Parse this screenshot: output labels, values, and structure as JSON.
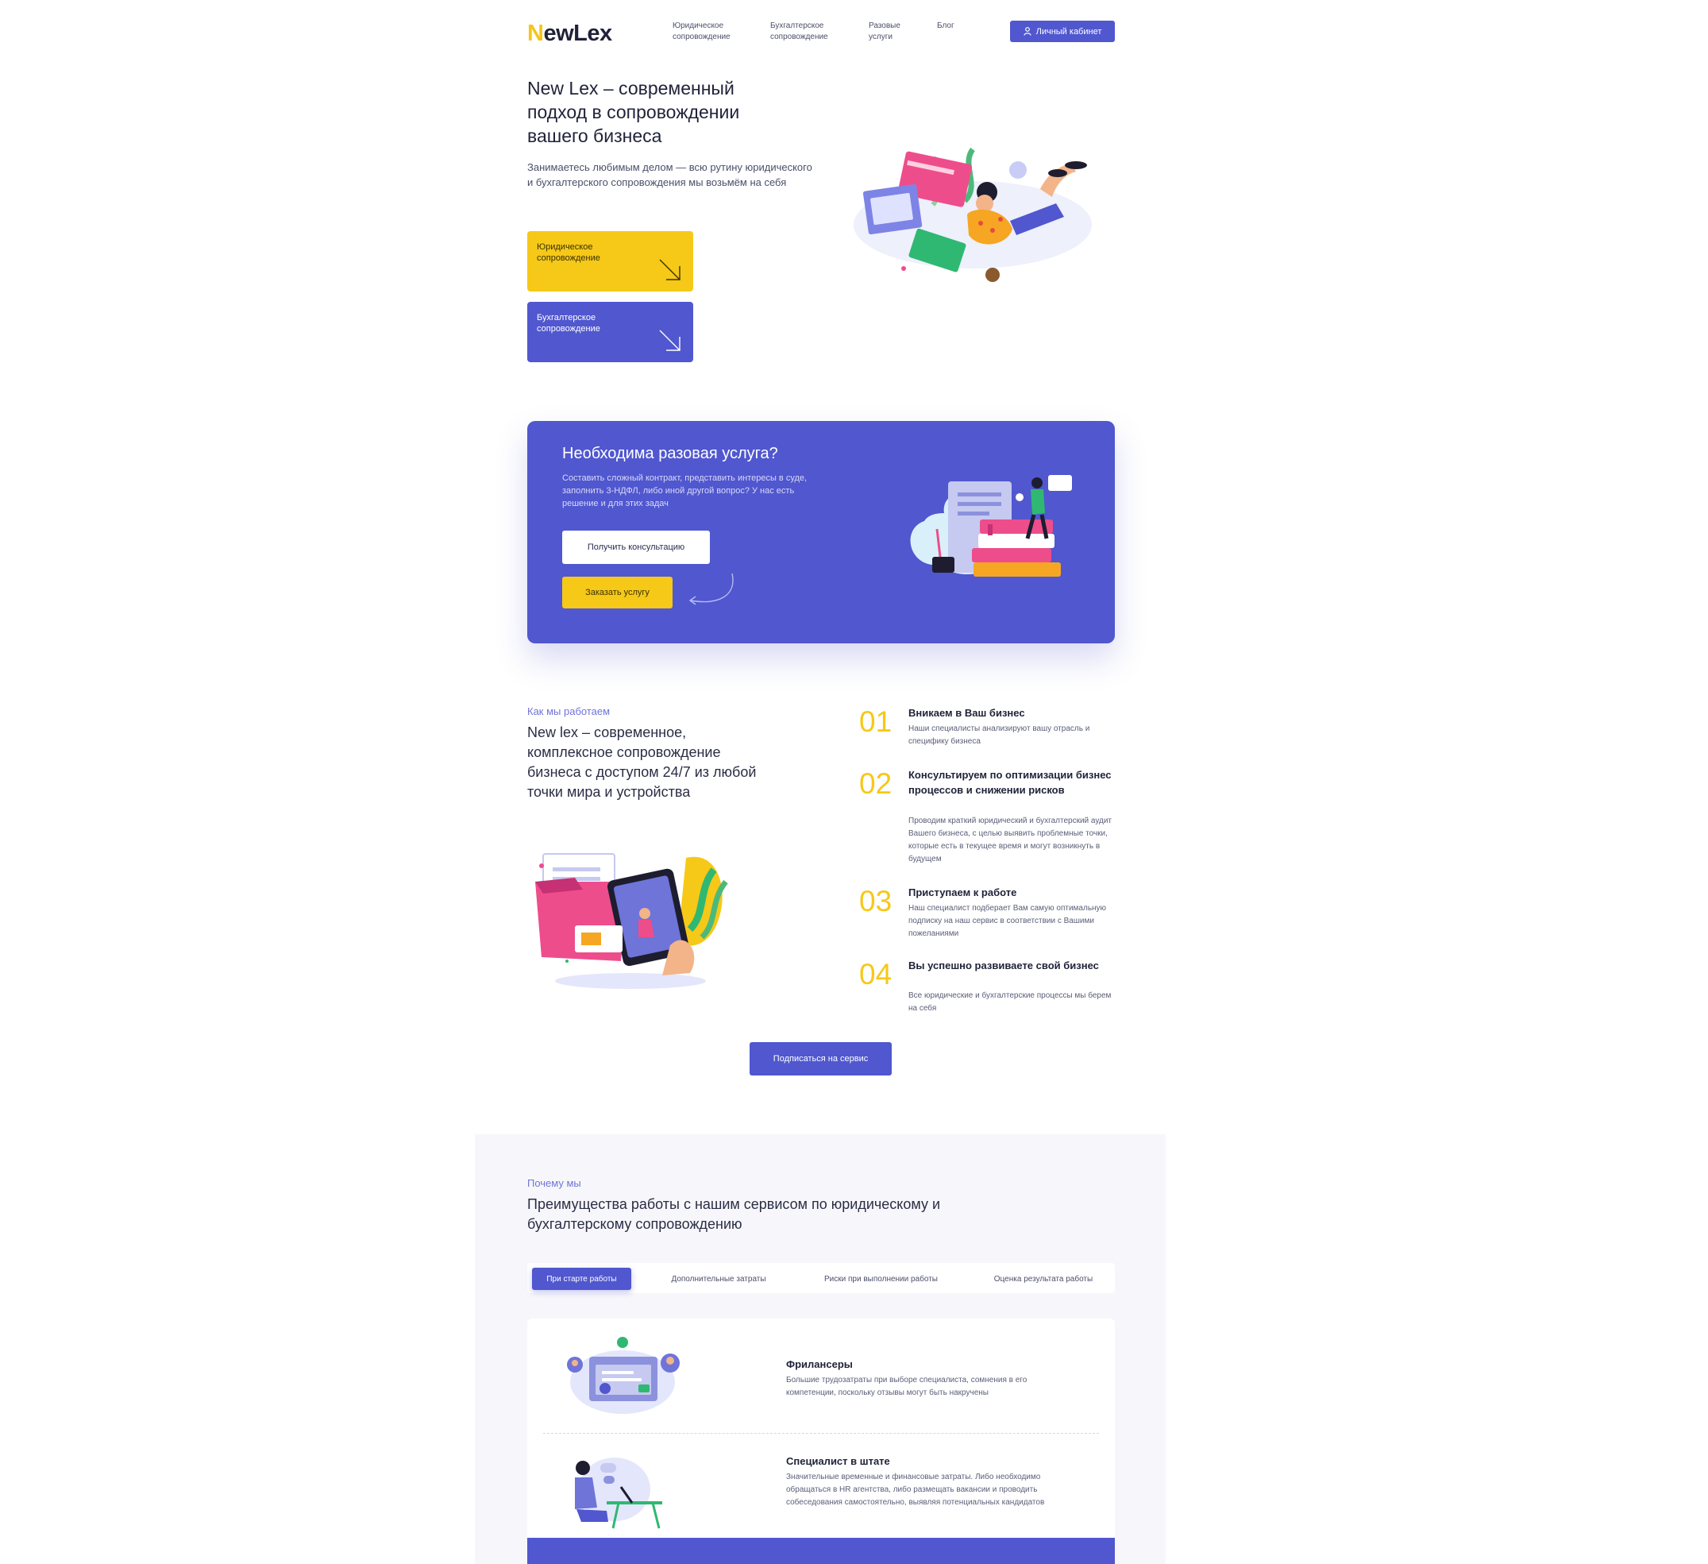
{
  "header": {
    "logo": "NewLex",
    "nav": [
      "Юридическое сопровождение",
      "Бухгалтерское сопровождение",
      "Разовые услуги",
      "Блог"
    ],
    "cabinet_label": "Личный кабинет"
  },
  "hero": {
    "title": "New Lex – современный подход в сопровождении вашего бизнеса",
    "description": "Занимаетесь любимым делом — всю рутину юридического и бухгалтерского сопровождения мы возьмём на себя",
    "cards": [
      "Юридическое сопровождение",
      "Бухгалтерское сопровождение"
    ]
  },
  "banner": {
    "title": "Необходима разовая услуга?",
    "description": "Составить сложный контракт, представить интересы в суде, заполнить 3-НДФЛ, либо иной другой вопрос? У нас есть решение и для этих задач",
    "consult_label": "Получить консультацию",
    "order_label": "Заказать услугу"
  },
  "how": {
    "kicker": "Как мы работаем",
    "title": "New lex – современное, комплексное сопровождение бизнеса с доступом 24/7 из любой точки мира и устройства",
    "steps": [
      {
        "num": "01",
        "title": "Вникаем в Ваш бизнес",
        "desc": "Наши специалисты анализируют вашу отрасль и специфику бизнеса"
      },
      {
        "num": "02",
        "title": "Консультируем по оптимизации бизнес процессов и снижении рисков",
        "desc": "Проводим краткий юридический и бухгалтерский аудит Вашего бизнеса, с целью выявить проблемные точки, которые есть в текущее время и могут возникнуть в будущем"
      },
      {
        "num": "03",
        "title": "Приступаем к работе",
        "desc": "Наш специалист подберает Вам самую оптимальную подписку на наш сервис в соответствии с Вашими пожеланиями"
      },
      {
        "num": "04",
        "title": "Вы успешно развиваете свой бизнес",
        "desc": "Все юридические и бухгалтерские процессы мы берем на себя"
      }
    ],
    "subscribe_label": "Подписаться на сервис"
  },
  "why": {
    "kicker": "Почему мы",
    "title": "Преимущества работы с нашим сервисом по юридическому и бухгалтерскому сопровождению",
    "tabs": [
      "При старте работы",
      "Дополнительные затраты",
      "Риски при выполнении работы",
      "Оценка результата работы"
    ],
    "active_tab": 0,
    "items": [
      {
        "title": "Фрилансеры",
        "desc": "Большие трудозатраты при выборе специалиста, сомнения в его компетенции, поскольку отзывы могут быть накручены"
      },
      {
        "title": "Специалист в штате",
        "desc": "Значительные временные и финансовые затраты. Либо необходимо обращаться в HR агентства, либо размещать вакансии и проводить собеседования самостоятельно, выявляя потенциальных кандидатов"
      }
    ]
  },
  "colors": {
    "accent": "#5057cf",
    "yellow": "#f6c818",
    "text": "#1f2238"
  },
  "icons": [
    "user-icon",
    "arrow-down-right-icon"
  ]
}
